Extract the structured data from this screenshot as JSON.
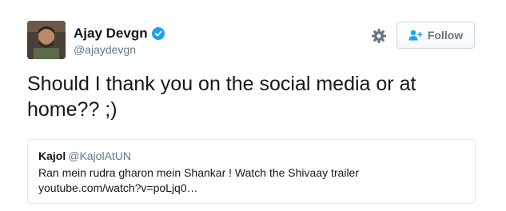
{
  "author": {
    "display_name": "Ajay Devgn",
    "handle": "@ajaydevgn",
    "verified": true
  },
  "actions": {
    "settings_icon": "gear-icon",
    "follow_label": "Follow",
    "follow_icon": "add-person-icon"
  },
  "tweet": {
    "text": "Should I thank you on the social media or at\nhome?? ;)"
  },
  "quoted_tweet": {
    "display_name": "Kajol",
    "handle": "@KajolAtUN",
    "text_line1": "Ran mein rudra gharon mein Shankar ! Watch the Shivaay trailer",
    "text_line2": "youtube.com/watch?v=poLjq0…"
  },
  "colors": {
    "verified_blue": "#1da1f2",
    "secondary_text": "#657786",
    "border": "#e1e8ed"
  }
}
